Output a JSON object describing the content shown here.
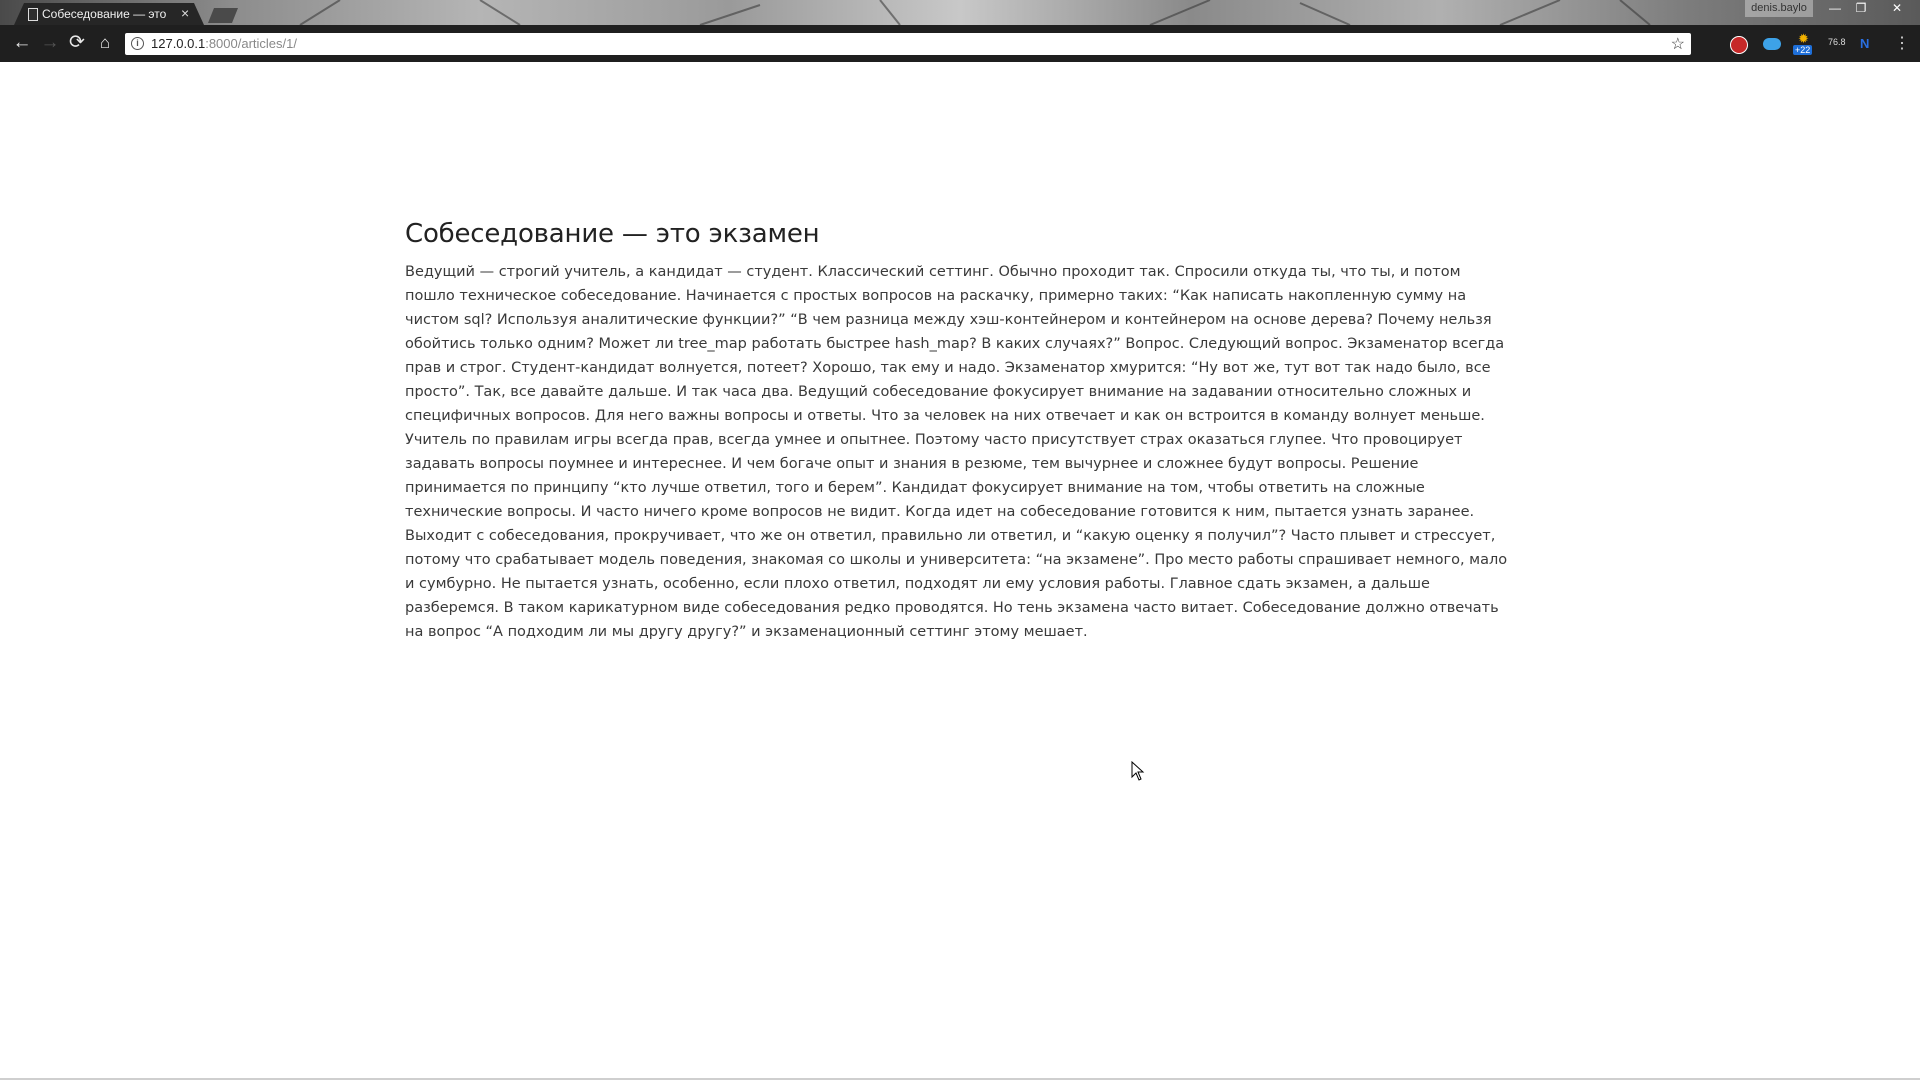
{
  "window": {
    "profile_name": "denis.baylo",
    "minimize": "—",
    "maximize": "❐",
    "close": "✕"
  },
  "tab": {
    "title": "Собеседование — это",
    "close": "×"
  },
  "toolbar": {
    "back": "←",
    "forward": "→",
    "reload": "⟳",
    "home": "⌂",
    "url_host": "127.0.0.1",
    "url_path": ":8000/articles/1/",
    "star": "☆",
    "weather_badge": "+22",
    "temperature": "76.8",
    "ext_letter": "N",
    "menu": "⋮"
  },
  "article": {
    "title": "Собеседование — это экзамен",
    "body": "Ведущий — строгий учитель, а кандидат — студент. Классический сеттинг. Обычно проходит так. Спросили откуда ты, что ты, и потом пошло техническое собеседование. Начинается с простых вопросов на раскачку, примерно таких: “Как написать накопленную сумму на чистом sql? Используя аналитические функции?” “В чем разница между хэш-контейнером и контейнером на основе дерева? Почему нельзя обойтись только одним? Может ли tree_map работать быстрее hash_map? В каких случаях?” Вопрос. Следующий вопрос. Экзаменатор всегда прав и строг. Студент-кандидат волнуется, потеет? Хорошо, так ему и надо. Экзаменатор хмурится: “Ну вот же, тут вот так надо было, все просто”. Так, все давайте дальше. И так часа два. Ведущий собеседование фокусирует внимание на задавании относительно сложных и специфичных вопросов. Для него важны вопросы и ответы. Что за человек на них отвечает и как он встроится в команду волнует меньше. Учитель по правилам игры всегда прав, всегда умнее и опытнее. Поэтому часто присутствует страх оказаться глупее. Что провоцирует задавать вопросы поумнее и интереснее. И чем богаче опыт и знания в резюме, тем вычурнее и сложнее будут вопросы. Решение принимается по принципу “кто лучше ответил, того и берем”. Кандидат фокусирует внимание на том, чтобы ответить на сложные технические вопросы. И часто ничего кроме вопросов не видит. Когда идет на собеседование готовится к ним, пытается узнать заранее. Выходит с собеседования, прокручивает, что же он ответил, правильно ли ответил, и “какую оценку я получил”? Часто плывет и стрессует, потому что срабатывает модель поведения, знакомая со школы и университета: “на экзамене”. Про место работы спрашивает немного, мало и сумбурно. Не пытается узнать, особенно, если плохо ответил, подходят ли ему условия работы. Главное сдать экзамен, а дальше разберемся. В таком карикатурном виде собеседования редко проводятся. Но тень экзамена часто витает. Собеседование должно отвечать на вопрос “А подходим ли мы другу другу?” и экзаменационный сеттинг этому мешает."
  }
}
